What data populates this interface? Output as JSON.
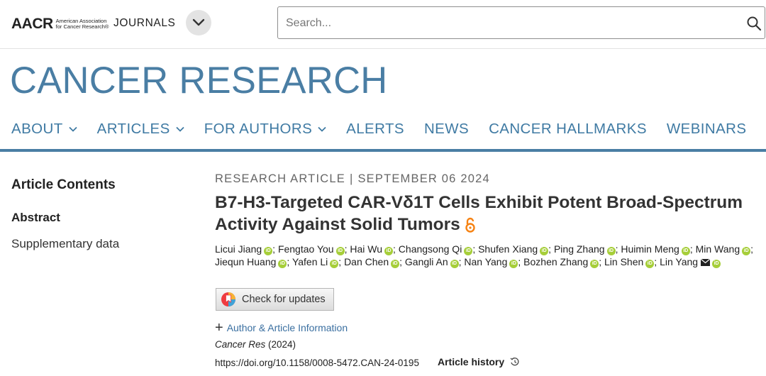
{
  "header": {
    "logo_mark": "AACR",
    "logo_subtitle": "American Association for Cancer Research®",
    "journals_label": "JOURNALS",
    "search_placeholder": "Search..."
  },
  "masthead": {
    "journal_title": "CANCER RESEARCH",
    "nav": [
      {
        "label": "ABOUT",
        "has_dropdown": true
      },
      {
        "label": "ARTICLES",
        "has_dropdown": true
      },
      {
        "label": "FOR AUTHORS",
        "has_dropdown": true
      },
      {
        "label": "ALERTS",
        "has_dropdown": false
      },
      {
        "label": "NEWS",
        "has_dropdown": false
      },
      {
        "label": "CANCER HALLMARKS",
        "has_dropdown": false
      },
      {
        "label": "WEBINARS",
        "has_dropdown": false
      }
    ]
  },
  "sidebar": {
    "heading": "Article Contents",
    "items": [
      "Abstract",
      "Supplementary data"
    ]
  },
  "article": {
    "type": "RESEARCH ARTICLE",
    "separator": "|",
    "date": "SEPTEMBER 06 2024",
    "title": "B7-H3-Targeted CAR-Vδ1T Cells Exhibit Potent Broad-Spectrum Activity Against Solid Tumors",
    "authors": [
      "Licui Jiang",
      "Fengtao You",
      "Hai Wu",
      "Changsong Qi",
      "Shufen Xiang",
      "Ping Zhang",
      "Huimin Meng",
      "Min Wang",
      "Jiequn Huang",
      "Yafen Li",
      "Dan Chen",
      "Gangli An",
      "Nan Yang",
      "Bozhen Zhang",
      "Lin Shen",
      "Lin Yang"
    ],
    "orcid_badge": "iD",
    "check_updates_label": "Check for updates",
    "author_info_label": "Author & Article Information",
    "citation_journal": "Cancer Res",
    "citation_year": " (2024)",
    "doi": "https://doi.org/10.1158/0008-5472.CAN-24-0195",
    "history_label": "Article history"
  },
  "colors": {
    "brand_blue": "#4a7ea4",
    "link_blue": "#3a6fa0",
    "orcid_green": "#a6ce39",
    "open_access_orange": "#f68212"
  }
}
